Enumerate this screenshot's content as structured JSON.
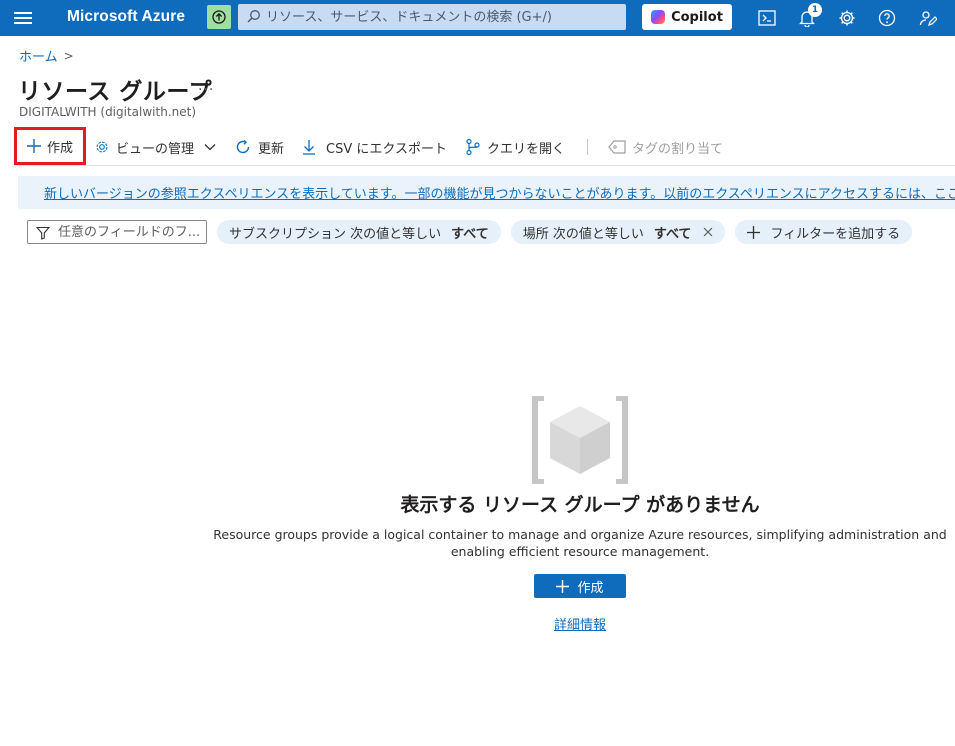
{
  "topbar": {
    "brand": "Microsoft Azure",
    "search_placeholder": "リソース、サービス、ドキュメントの検索 (G+/)",
    "copilot_label": "Copilot",
    "notification_count": "1",
    "accent": "#0f6cbd"
  },
  "breadcrumb": {
    "home": "ホーム",
    "separator": ">"
  },
  "page": {
    "title": "リソース グループ",
    "more": "...",
    "subtitle": "DIGITALWITH (digitalwith.net)"
  },
  "commands": {
    "create": "作成",
    "manage_view": "ビューの管理",
    "refresh": "更新",
    "export_csv": "CSV にエクスポート",
    "open_query": "クエリを開く",
    "assign_tags": "タグの割り当て"
  },
  "info_banner": {
    "text": "新しいバージョンの参照エクスペリエンスを表示しています。一部の機能が見つからないことがあります。以前のエクスペリエンスにアクセスするには、ここをクリックしてください。"
  },
  "filters": {
    "field_placeholder": "任意のフィールドのフ...",
    "subscription": {
      "label": "サブスクリプション 次の値と等しい",
      "value": "すべて"
    },
    "location": {
      "label": "場所 次の値と等しい",
      "value": "すべて"
    },
    "add_filter": "フィルターを追加する"
  },
  "empty_state": {
    "title": "表示する リソース グループ がありません",
    "description_line1": "Resource groups provide a logical container to manage and organize Azure resources, simplifying administration and",
    "description_line2": "enabling efficient resource management.",
    "create": "作成",
    "learn_more": "詳細情報"
  }
}
